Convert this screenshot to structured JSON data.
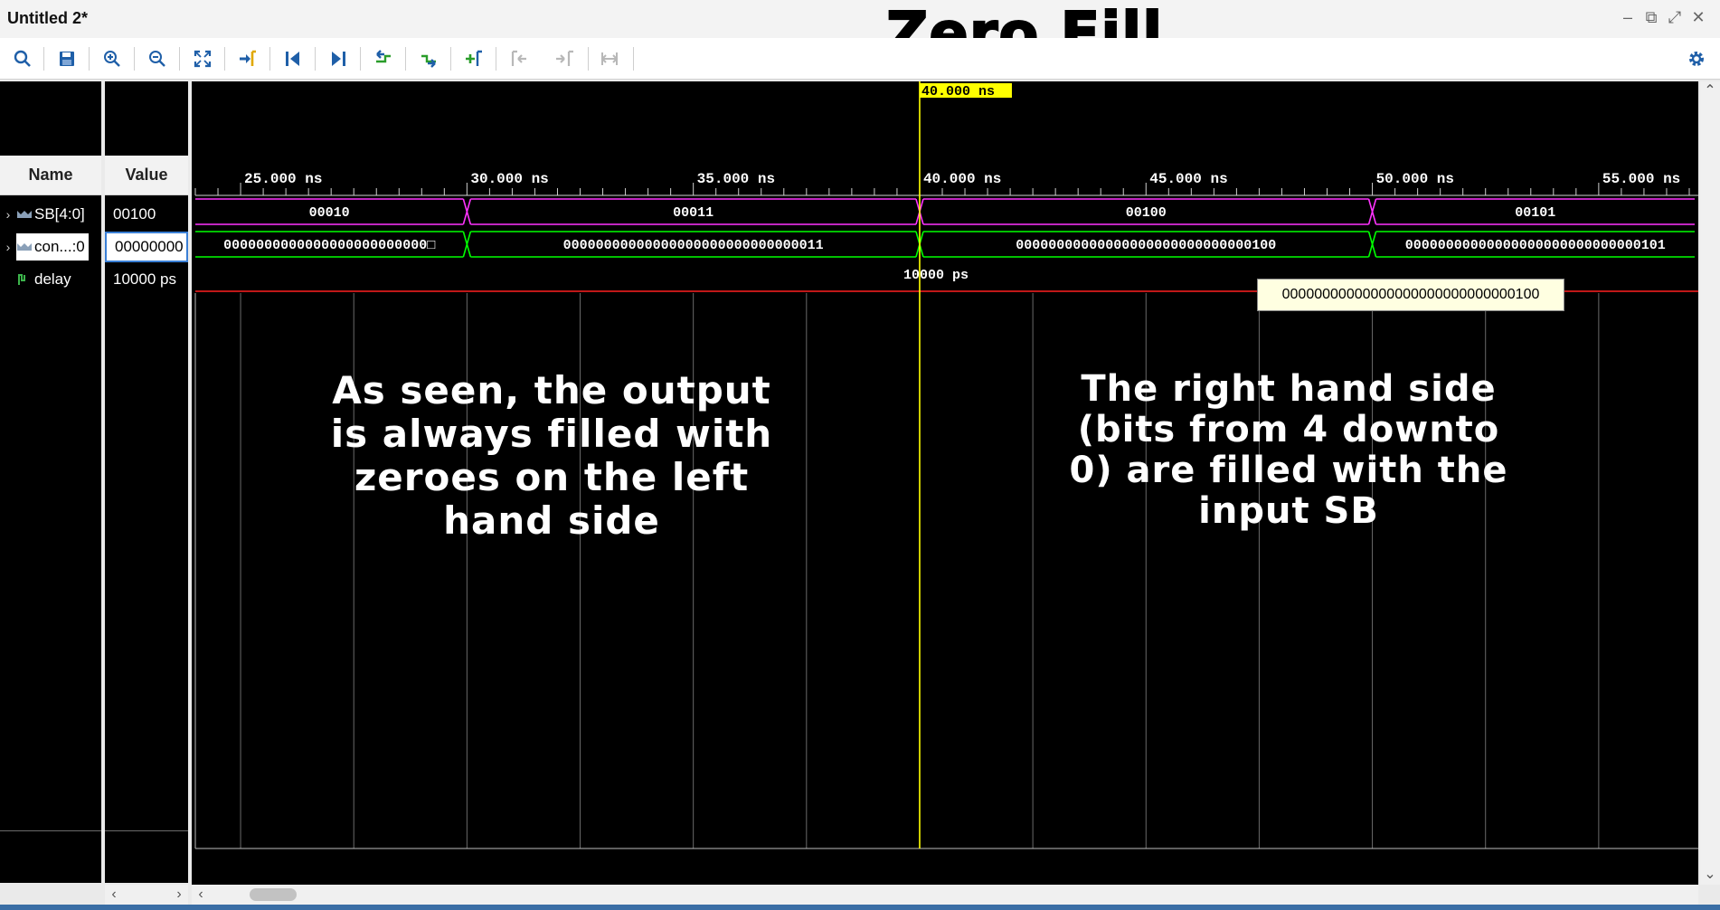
{
  "window": {
    "title": "Untitled 2*",
    "banner": "Zero Fill",
    "controls": {
      "minimize": "–",
      "restore": "⧉",
      "maximize": "⤢",
      "close": "✕"
    }
  },
  "toolbar": {
    "buttons": [
      {
        "name": "search-icon",
        "label": "Search"
      },
      {
        "name": "save-icon",
        "label": "Save"
      },
      {
        "name": "zoom-in-icon",
        "label": "Zoom In"
      },
      {
        "name": "zoom-out-icon",
        "label": "Zoom Out"
      },
      {
        "name": "zoom-fit-icon",
        "label": "Zoom Fit"
      },
      {
        "name": "go-to-cursor-icon",
        "label": "Go to Cursor"
      },
      {
        "name": "go-to-time-zero-icon",
        "label": "Go to Time 0"
      },
      {
        "name": "go-to-last-time-icon",
        "label": "Go to Last Time"
      },
      {
        "name": "previous-transition-icon",
        "label": "Previous Transition"
      },
      {
        "name": "next-transition-icon",
        "label": "Next Transition"
      },
      {
        "name": "add-marker-icon",
        "label": "Add Marker"
      },
      {
        "name": "previous-marker-icon",
        "label": "Previous Marker"
      },
      {
        "name": "next-marker-icon",
        "label": "Next Marker"
      },
      {
        "name": "swap-cursors-icon",
        "label": "Swap Cursors"
      }
    ],
    "settings_icon": "gear-icon"
  },
  "columns": {
    "name": "Name",
    "value": "Value"
  },
  "signals": [
    {
      "name": "SB[4:0]",
      "value": "00100",
      "expandable": true,
      "icon": "bus-icon"
    },
    {
      "name": "con...:0",
      "value": "00000000",
      "expandable": true,
      "icon": "bus-icon",
      "selected": true
    },
    {
      "name": "delay",
      "value": "10000 ps",
      "expandable": false,
      "icon": "signal-icon"
    }
  ],
  "waveform": {
    "cursor_label": "40.000 ns",
    "cursor_time_ns": 40.0,
    "time_axis": {
      "labels": [
        "25.000 ns",
        "30.000 ns",
        "35.000 ns",
        "40.000 ns",
        "45.000 ns",
        "50.000 ns",
        "55.000 ns"
      ],
      "ticks_ns": [
        25,
        30,
        35,
        40,
        45,
        50,
        55
      ],
      "view_start_ns": 24.0,
      "view_end_ns": 57.2
    },
    "sb_segments": [
      {
        "from_ns": 24.0,
        "to_ns": 30.0,
        "value": "00010"
      },
      {
        "from_ns": 30.0,
        "to_ns": 40.0,
        "value": "00011"
      },
      {
        "from_ns": 40.0,
        "to_ns": 50.0,
        "value": "00100"
      },
      {
        "from_ns": 50.0,
        "to_ns": 57.2,
        "value": "00101"
      }
    ],
    "out_segments": [
      {
        "from_ns": 24.0,
        "to_ns": 30.0,
        "value": "0000000000000000000000000□"
      },
      {
        "from_ns": 30.0,
        "to_ns": 40.0,
        "value": "00000000000000000000000000000011"
      },
      {
        "from_ns": 40.0,
        "to_ns": 50.0,
        "value": "00000000000000000000000000000100"
      },
      {
        "from_ns": 50.0,
        "to_ns": 57.2,
        "value": "00000000000000000000000000000101"
      }
    ],
    "delay_label": "10000 ps",
    "tooltip": "00000000000000000000000000000100",
    "colors": {
      "bus": "#ff33ff",
      "out": "#00ff00",
      "cursor": "#ffff00",
      "grid": "#6a6a6a",
      "delay": "#ff2020",
      "text": "#ffffff"
    }
  },
  "annotations": {
    "left": [
      "As seen, the output",
      "is always filled with",
      "zeroes on the left",
      "hand side"
    ],
    "right": [
      "The right hand side",
      "(bits from 4 downto",
      "0) are filled with the",
      "input SB"
    ]
  }
}
